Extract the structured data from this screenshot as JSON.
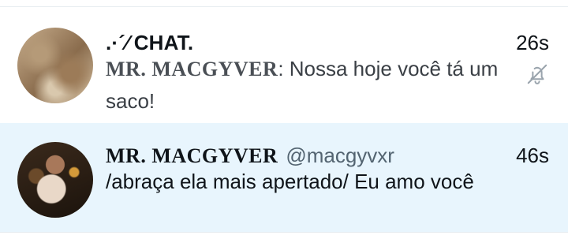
{
  "conversations": [
    {
      "title_symbol": ".·´⁄",
      "title": "CHAT.",
      "time": "26s",
      "sender": "MR. MACGYVER",
      "separator": ": ",
      "message": "Nossa hoje você tá um saco!",
      "muted": true
    },
    {
      "sender": "MR. MACGYVER",
      "handle": "@macgyvxr",
      "time": "46s",
      "message": "/abraça ela mais apertado/ Eu amo você"
    }
  ],
  "colors": {
    "highlight_row": "#e8f5fd",
    "secondary_text": "#536471"
  },
  "icons": {
    "mute": "bell-off-icon"
  }
}
